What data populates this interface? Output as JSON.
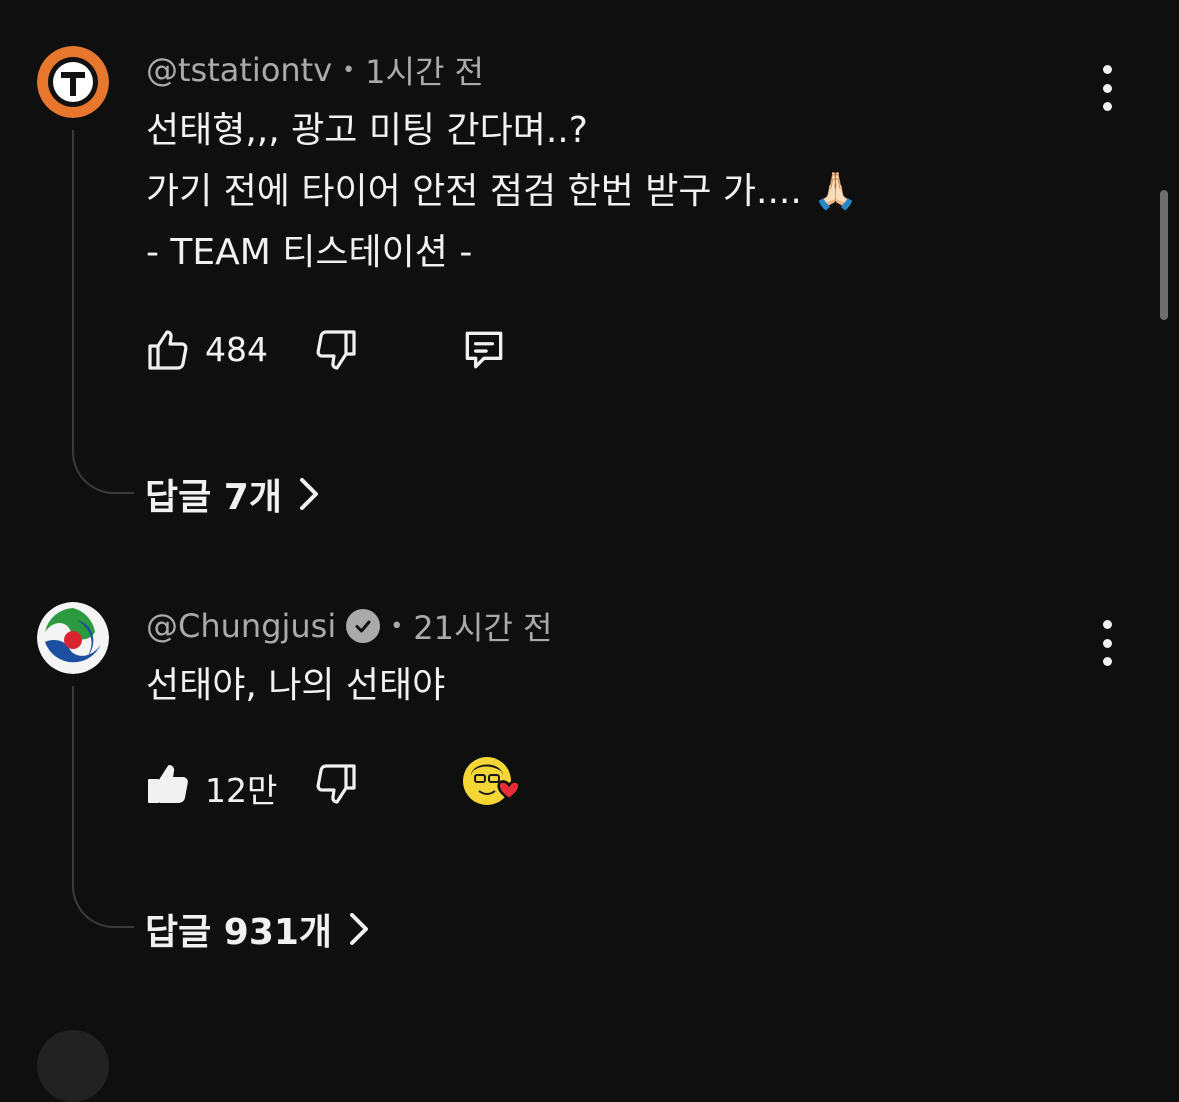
{
  "comments": [
    {
      "handle": "@tstationtv",
      "time": "1시간 전",
      "verified": false,
      "lines": [
        "선태형,,, 광고 미팅 간다며..?",
        "가기 전에 타이어 안전 점검 한번 받구 가.... 🙏🏻",
        "- TEAM 티스테이션  -"
      ],
      "likes": "484",
      "liked": false,
      "creator_heart": false,
      "has_reply_button": true,
      "avatar_icon": "tstation-logo-icon",
      "replies_label": "답글 7개"
    },
    {
      "handle": "@Chungjusi",
      "time": "21시간 전",
      "verified": true,
      "lines": [
        "선태야, 나의 선태야"
      ],
      "likes": "12만",
      "liked": true,
      "creator_heart": true,
      "has_reply_button": false,
      "avatar_icon": "chungju-city-emblem-icon",
      "replies_label": "답글 931개"
    }
  ],
  "separator": "•",
  "colors": {
    "background": "#0f0f0f",
    "text_primary": "#f1f1f1",
    "text_secondary": "#aaaaaa",
    "thread_line": "#3a3a3a",
    "tstation_orange": "#e8772e",
    "heart_red": "#e82c3a"
  }
}
